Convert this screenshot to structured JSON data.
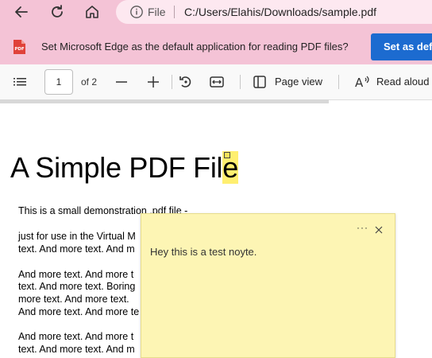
{
  "browser": {
    "back_icon": "arrow-left-icon",
    "refresh_icon": "refresh-icon",
    "home_icon": "home-icon",
    "info_icon": "info-icon",
    "file_label": "File",
    "url": "C:/Users/Elahis/Downloads/sample.pdf"
  },
  "infobar": {
    "icon": "pdf-icon",
    "message": "Set Microsoft Edge as the default application for reading PDF files?",
    "button_label": "Set as default"
  },
  "toolbar": {
    "contents_icon": "list-icon",
    "page_number": "1",
    "page_of": "of 2",
    "zoom_out_icon": "minus-icon",
    "zoom_in_icon": "plus-icon",
    "rotate_icon": "rotate-icon",
    "fit_icon": "fit-width-icon",
    "page_view_icon": "page-view-icon",
    "page_view_label": "Page view",
    "read_aloud_icon": "read-aloud-icon",
    "read_aloud_label": "Read aloud"
  },
  "document": {
    "title_main": "A Simple PDF Fil",
    "title_highlight": "e",
    "lines": [
      "This is a small demonstration .pdf file -",
      "just for use in the Virtual M",
      "text. And more text. And m",
      "And more text. And more t",
      "text. And more text. Boring",
      "more text. And more text.",
      "And more text. And more te",
      "And more text. And more t",
      "text. And more text. And m"
    ]
  },
  "note": {
    "more_label": "···",
    "close_icon": "close-icon",
    "text": "Hey this is a test noyte."
  }
}
